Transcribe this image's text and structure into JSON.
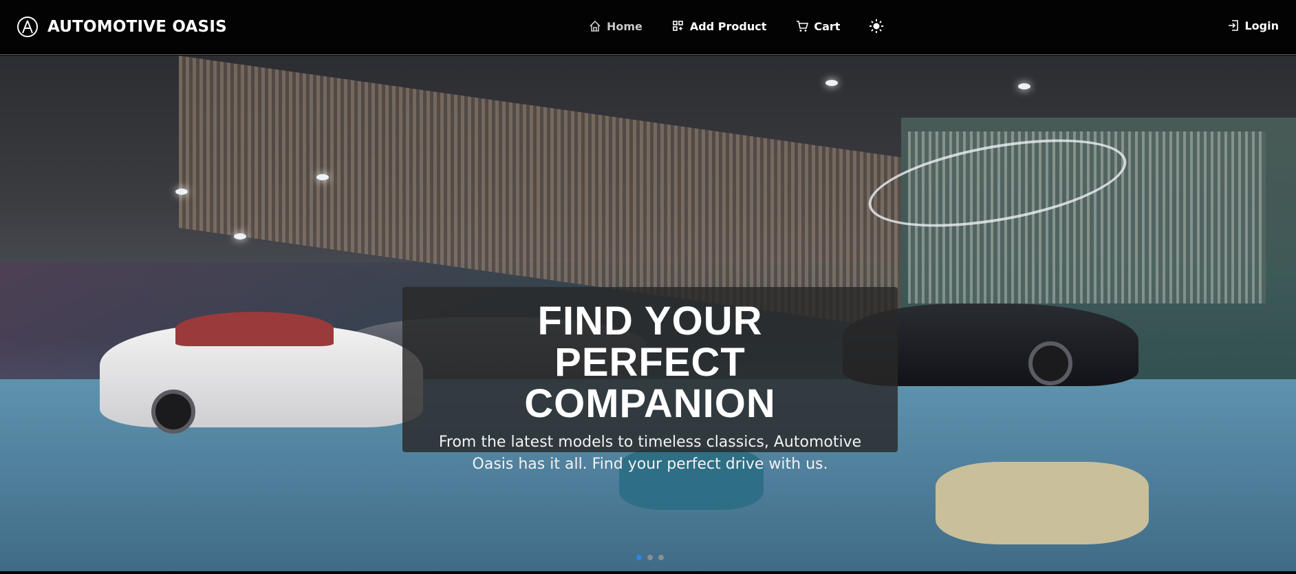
{
  "brand": {
    "name": "AUTOMOTIVE OASIS",
    "logo_icon": "acura-logo-icon"
  },
  "nav": {
    "items": [
      {
        "label": "Home",
        "icon": "home-icon",
        "active": true
      },
      {
        "label": "Add Product",
        "icon": "grid-add-icon",
        "active": false
      },
      {
        "label": "Cart",
        "icon": "cart-icon",
        "active": false
      }
    ],
    "theme_toggle_icon": "sun-icon",
    "login_label": "Login",
    "login_icon": "login-icon"
  },
  "hero": {
    "title": "FIND YOUR PERFECT COMPANION",
    "text": "From the latest models to timeless classics, Automotive Oasis has it all. Find your perfect drive with us.",
    "slides": 3,
    "active_slide": 1,
    "indicator_active_color": "#2e86de"
  }
}
